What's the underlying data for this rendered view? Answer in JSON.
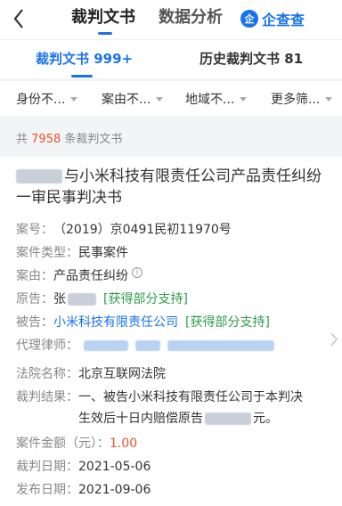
{
  "header": {
    "tabs": [
      {
        "label": "裁判文书"
      },
      {
        "label": "数据分析"
      }
    ],
    "brand": {
      "logo": "企",
      "text": "企查查"
    }
  },
  "subtabs": [
    {
      "label": "裁判文书 999+"
    },
    {
      "label": "历史裁判文书 81"
    }
  ],
  "filters": [
    {
      "label": "身份不..."
    },
    {
      "label": "案由不..."
    },
    {
      "label": "地域不..."
    },
    {
      "label": "更多筛..."
    }
  ],
  "count": {
    "prefix": "共",
    "number": "7958",
    "suffix": "条裁判文书"
  },
  "card": {
    "title": "与小米科技有限责任公司产品责任纠纷一审民事判决书",
    "case_no": {
      "label": "案号：",
      "value": "（2019）京0491民初11970号"
    },
    "case_type": {
      "label": "案件类型：",
      "value": "民事案件"
    },
    "cause": {
      "label": "案由：",
      "value": "产品责任纠纷"
    },
    "plaintiff": {
      "label": "原告：",
      "name": "张",
      "tag": "[获得部分支持]"
    },
    "defendant": {
      "label": "被告：",
      "name": "小米科技有限责任公司",
      "tag": "[获得部分支持]"
    },
    "lawyer": {
      "label": "代理律师："
    },
    "court": {
      "label": "法院名称：",
      "value": "北京互联网法院"
    },
    "result": {
      "label": "裁判结果：",
      "line1": "一、被告小米科技有限责任公司于本判决",
      "line2_pre": "生效后十日内赔偿原告",
      "line2_post": "元。"
    },
    "amount": {
      "label": "案件金额（元）：",
      "value": "1.00"
    },
    "judge_date": {
      "label": "裁判日期：",
      "value": "2021-05-06"
    },
    "publish_date": {
      "label": "发布日期：",
      "value": "2021-09-06"
    }
  },
  "colors": {
    "accent": "#1a73e8",
    "count": "#e8542f",
    "support": "#2c9c4a"
  }
}
